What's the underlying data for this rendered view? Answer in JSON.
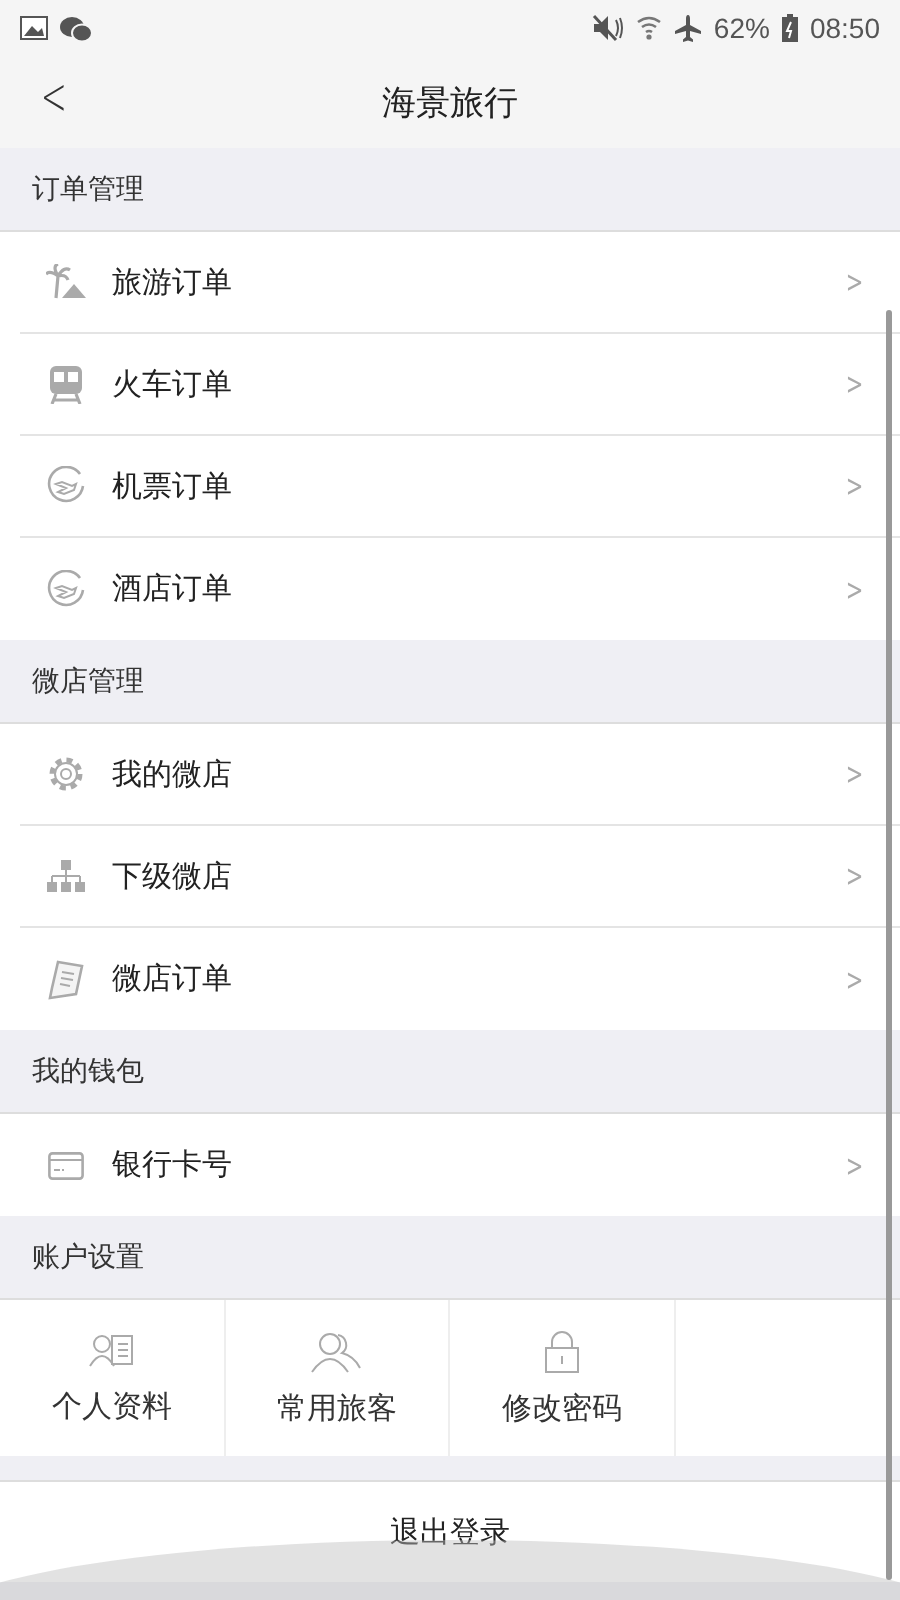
{
  "status_bar": {
    "battery": "62%",
    "time": "08:50"
  },
  "header": {
    "back": "<",
    "title": "海景旅行"
  },
  "sections": [
    {
      "title": "订单管理",
      "items": [
        {
          "label": "旅游订单",
          "chevron": ">"
        },
        {
          "label": "火车订单",
          "chevron": ">"
        },
        {
          "label": "机票订单",
          "chevron": ">"
        },
        {
          "label": "酒店订单",
          "chevron": ">"
        }
      ]
    },
    {
      "title": "微店管理",
      "items": [
        {
          "label": "我的微店",
          "chevron": ">"
        },
        {
          "label": "下级微店",
          "chevron": ">"
        },
        {
          "label": "微店订单",
          "chevron": ">"
        }
      ]
    },
    {
      "title": "我的钱包",
      "items": [
        {
          "label": "银行卡号",
          "chevron": ">"
        }
      ]
    }
  ],
  "account": {
    "title": "账户设置",
    "tiles": [
      {
        "label": "个人资料"
      },
      {
        "label": "常用旅客"
      },
      {
        "label": "修改密码"
      }
    ]
  },
  "logout": "退出登录"
}
